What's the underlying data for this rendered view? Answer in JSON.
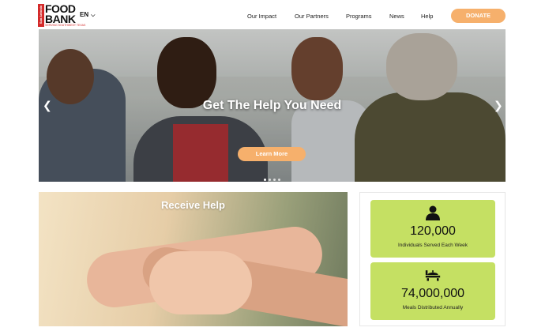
{
  "header": {
    "logo": {
      "side_text": "San Antonio",
      "line1": "FOOD",
      "line2": "BANK",
      "tagline": "SERVING SOUTHWEST TEXAS"
    },
    "language": "EN",
    "nav": [
      "Our Impact",
      "Our Partners",
      "Programs",
      "News",
      "Help"
    ],
    "donate_label": "DONATE"
  },
  "hero": {
    "title": "Get The Help You Need",
    "button_label": "Learn More",
    "slides": 4,
    "active_slide": 1
  },
  "receive_help": {
    "title": "Receive Help"
  },
  "stats": [
    {
      "icon": "person-icon",
      "value": "120,000",
      "label": "Individuals Served Each Week"
    },
    {
      "icon": "food-tray-icon",
      "value": "74,000,000",
      "label": "Meals Distributed Annually"
    }
  ],
  "colors": {
    "accent_orange": "#f6b06c",
    "stat_green": "#c5e063",
    "logo_red": "#d42a2a"
  }
}
